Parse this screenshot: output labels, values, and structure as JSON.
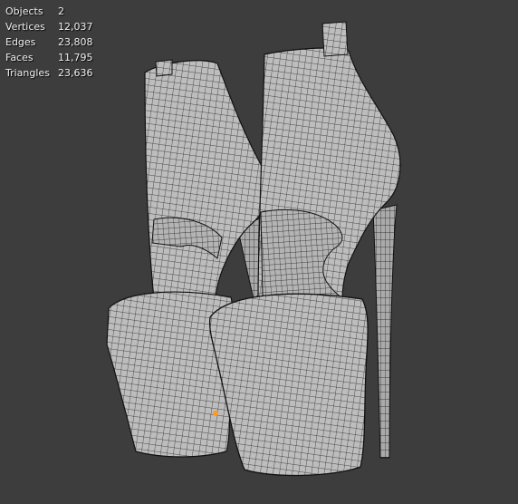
{
  "overlay": {
    "stats": [
      {
        "label": "Objects",
        "value": "2"
      },
      {
        "label": "Vertices",
        "value": "12,037"
      },
      {
        "label": "Edges",
        "value": "23,808"
      },
      {
        "label": "Faces",
        "value": "11,795"
      },
      {
        "label": "Triangles",
        "value": "23,636"
      }
    ]
  },
  "colors": {
    "background": "#3d3d3d",
    "mesh_fill": "#b9b9b9",
    "wire": "#1a1a1a",
    "origin": "#ff9a1f"
  }
}
